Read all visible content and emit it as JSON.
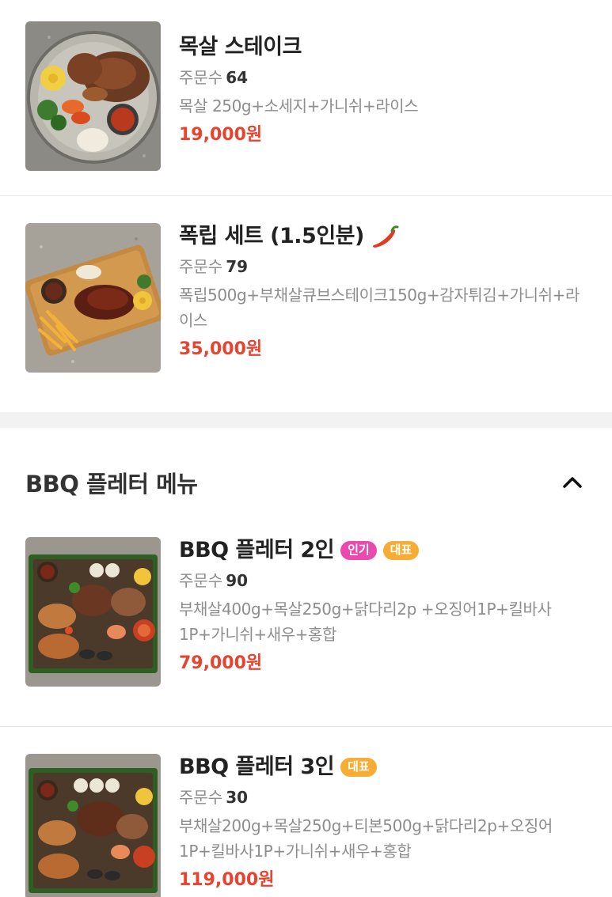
{
  "items_top": [
    {
      "name": "목살 스테이크",
      "orders_label": "주문수",
      "orders_count": "64",
      "description": "목살 250g+소세지+가니쉬+라이스",
      "price": "19,000원"
    },
    {
      "name": "폭립 세트 (1.5인분)",
      "orders_label": "주문수",
      "orders_count": "79",
      "description": "폭립500g+부채살큐브스테이크150g+감자튀김+가니쉬+라이스",
      "price": "35,000원",
      "icon": "chili-pepper-icon"
    }
  ],
  "section": {
    "title": "BBQ 플레터 메뉴",
    "toggle_icon": "chevron-up-icon"
  },
  "items_bbq": [
    {
      "name": "BBQ 플레터 2인",
      "badges": [
        "인기",
        "대표"
      ],
      "orders_label": "주문수",
      "orders_count": "90",
      "description": "부채살400g+목살250g+닭다리2p +오징어1P+킬바사1P+가니쉬+새우+홍합",
      "price": "79,000원"
    },
    {
      "name": "BBQ 플레터 3인",
      "badges": [
        "대표"
      ],
      "orders_label": "주문수",
      "orders_count": "30",
      "description": "부채살200g+목살250g+티본500g+닭다리2p+오징어1P+킬바사1P+가니쉬+새우+홍합",
      "price": "119,000원"
    }
  ],
  "colors": {
    "price": "#e8432f",
    "badge_popular": "#ea4ab0",
    "badge_signature": "#f7ac33",
    "section_gap": "#f2f2f2"
  }
}
